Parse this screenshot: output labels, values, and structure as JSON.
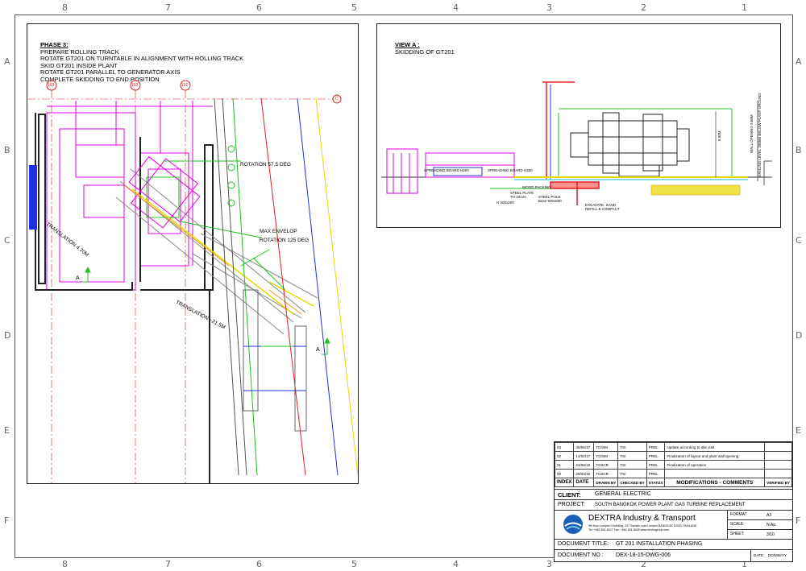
{
  "border_columns_top": [
    "8",
    "7",
    "6",
    "5",
    "4",
    "3",
    "2",
    "1"
  ],
  "border_rows_left": [
    "A",
    "B",
    "C",
    "D",
    "E",
    "F"
  ],
  "phase_notes": {
    "title": "PHASE 3:",
    "lines": [
      "PREPARE ROLLING TRACK",
      "ROTATE GT201 ON TURNTABLE IN ALIGNMENT WITH ROLLING TRACK",
      "SKID GT201 INSIDE PLANT",
      "ROTATE GT201 PARALLEL TO GENERATOR AXIS",
      "COMPLETE SKIDDING TO END POSITION"
    ]
  },
  "plan_view": {
    "grid_bubbles": [
      "103",
      "102",
      "101"
    ],
    "grid_bubble_right": "C",
    "labels": {
      "rotation_1": "ROTATION 57.5 DEG",
      "max_envelop": "MAX ENVELOP",
      "rotation_2": "ROTATION 125 DEG",
      "translation_1": "TRANSLATION 4.70M",
      "translation_2": "TRANSLATION ~21.5M",
      "section_a": "A"
    }
  },
  "view_a": {
    "title": "VIEW A :",
    "subtitle": "SKIDDING OF GT201",
    "labels": {
      "spreading_board_1": "SPREADING BOARD H200",
      "spreading_board_2": "SPREADING BOARD H200",
      "wood_packing": "WOOD PACKING",
      "steel_plate": "STEEL PLATE",
      "steel_plate_th": "TH 22mm",
      "h_beam": "H 200x200",
      "steel_pole": "STEEL POLE",
      "steel_pole_base": "Base 500x500",
      "excavate": "EXCAVATE, SAND",
      "refill": "REFILL & COMPACT",
      "ground_level": "GROUND LEVEL 2000M BELOW PLANT GROUND",
      "wall_opening": "WALL OPENING 9.68M",
      "dim": "6.58M"
    }
  },
  "revisions": [
    {
      "index": "03",
      "date": "30/05/17",
      "drawn": "TG/SM",
      "checked": "TSI",
      "status": "PREL",
      "comment": "Update according to site visit"
    },
    {
      "index": "02",
      "date": "14/02/17",
      "drawn": "TG/SM",
      "checked": "TSI",
      "status": "PREL",
      "comment": "Finalization of layout and plant wall opening"
    },
    {
      "index": "01",
      "date": "24/08/16",
      "drawn": "TG/ICR",
      "checked": "TSI",
      "status": "PREL",
      "comment": "Finalization of operation"
    },
    {
      "index": "00",
      "date": "29/04/16",
      "drawn": "TG/ICR",
      "checked": "TSI",
      "status": "PREL",
      "comment": ""
    }
  ],
  "rev_header": {
    "index": "INDEX",
    "date": "DATE",
    "drawn": "DRAWN BY",
    "checked": "CHECKED BY",
    "status": "STATUS",
    "comments": "MODIFICATIONS - COMMENTS",
    "verified": "VERIFIED BY"
  },
  "title_block": {
    "client_label": "CLIENT:",
    "client_value": "GENERAL ELECTRIC",
    "project_label": "PROJECT:",
    "project_value": "SOUTH BANGKOK POWER PLANT GAS TURBINE REPLACEMENT",
    "company_name": "DEXTRA Industry & Transport",
    "company_address": "9th floor Lumpini II building, 247 Sarasin road Lumpini BANGKOK 10330 THAILAND",
    "company_contact": "Tel: +662 651 8027  Fax: +662 651 8005  www.dextragroup.com",
    "format_label": "FORMAT",
    "format_value": "A3",
    "scale_label": "SCALE:",
    "scale_value": "N.Ap.",
    "sheet_label": "SHEET:",
    "sheet_value": "3/10",
    "doc_title_label": "DOCUMENT TITLE:",
    "doc_title_value": "GT 201 INSTALLATION PHASING",
    "doc_no_label": "DOCUMENT NO :",
    "doc_no_value": "DEX-18-15-DWG-006",
    "date_label": "DATE:",
    "date_value": "DD/MM/YY"
  },
  "colors": {
    "magenta": "#e000e0",
    "red": "#e02020",
    "green": "#20c020",
    "blue": "#2030e0",
    "yellow": "#e8d800",
    "grey": "#888888",
    "cyan": "#00b8d8",
    "brand": "#1a5fb4"
  }
}
